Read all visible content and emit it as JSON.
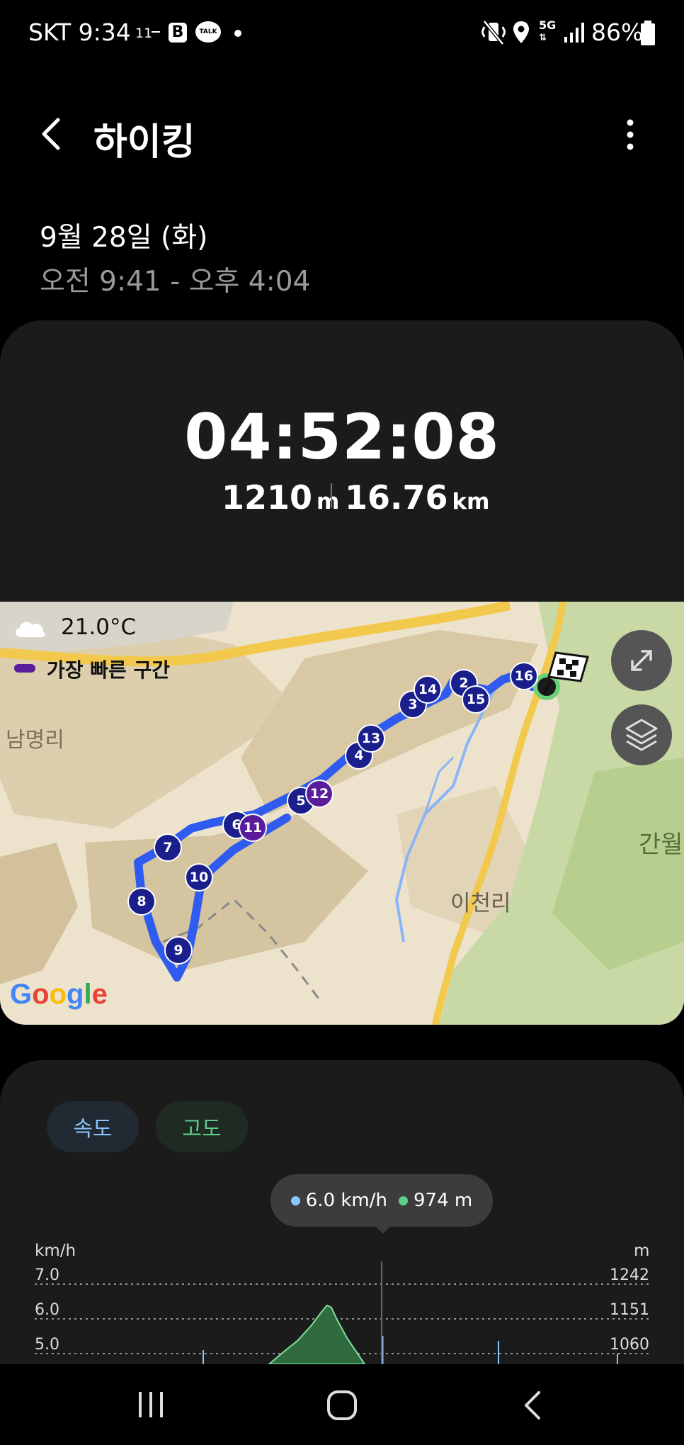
{
  "status_bar": {
    "carrier_time": "SKT 9:34",
    "app_badge": "11",
    "talk_badge": "TALK",
    "network": "5G",
    "battery": "86%"
  },
  "header": {
    "title": "하이킹",
    "back_icon": "chevron-left-icon",
    "more_icon": "more-vertical-icon"
  },
  "session": {
    "date": "9월 28일 (화)",
    "time_range": "오전 9:41 - 오후 4:04"
  },
  "summary": {
    "duration": "04:52:08",
    "elevation_value": "1210",
    "elevation_unit": "m",
    "distance_value": "16.76",
    "distance_unit": "km"
  },
  "map": {
    "temperature": "21.0°C",
    "legend_fastest": "가장 빠른 구간",
    "place_1": "남명리",
    "place_2": "간월",
    "place_3": "이천리",
    "google": "Google",
    "markers": [
      "2",
      "3",
      "4",
      "5",
      "6",
      "7",
      "8",
      "9",
      "10",
      "11",
      "12",
      "13",
      "14",
      "15",
      "16"
    ],
    "colors": {
      "route": "#2f5bf0",
      "marker": "#1a1f8c",
      "fastest": "#5a1c9a",
      "road": "#f2c94c",
      "water": "#8ab4f8",
      "land": "#e9dcc2",
      "park": "#c9d9a6"
    }
  },
  "chart": {
    "chip_speed": "속도",
    "chip_altitude": "고도",
    "tooltip_speed": "6.0 km/h",
    "tooltip_altitude": "974 m",
    "left_unit": "km/h",
    "right_unit": "m",
    "left_ticks": [
      "7.0",
      "6.0",
      "5.0"
    ],
    "right_ticks": [
      "1242",
      "1151",
      "1060"
    ],
    "colors": {
      "speed": "#8ec5ff",
      "altitude": "#5bd08a"
    }
  },
  "chart_data": {
    "type": "area",
    "title": "",
    "series": [
      {
        "name": "속도",
        "unit": "km/h",
        "ylim": [
          5.0,
          7.0
        ]
      },
      {
        "name": "고도",
        "unit": "m",
        "ylim": [
          1060,
          1242
        ]
      }
    ],
    "ylabel_left": "km/h",
    "ylabel_right": "m",
    "yticks_left": [
      7.0,
      6.0,
      5.0
    ],
    "yticks_right": [
      1242,
      1151,
      1060
    ],
    "grid": true,
    "selected_point": {
      "speed": 6.0,
      "altitude": 974
    }
  },
  "nav": {
    "recents_icon": "recents-icon",
    "home_icon": "home-icon",
    "back_icon": "back-icon"
  }
}
